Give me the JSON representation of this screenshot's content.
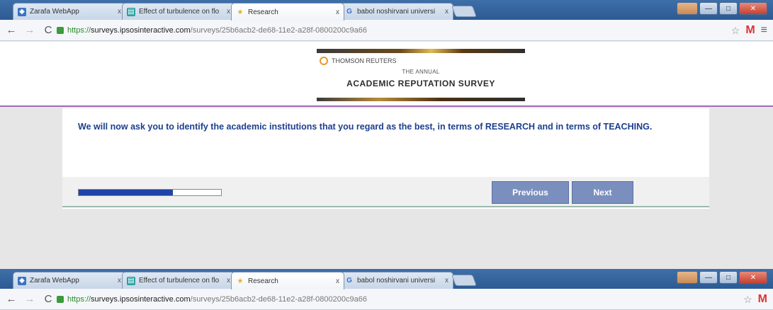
{
  "browser": {
    "tabs": [
      {
        "title": "Zarafa WebApp",
        "icon": "zarafa-icon",
        "color": "#3b73c4"
      },
      {
        "title": "Effect of turbulence on flo",
        "icon": "document-icon",
        "color": "#2aa0a0"
      },
      {
        "title": "Research",
        "icon": "star-icon",
        "color": "#e8b020"
      },
      {
        "title": "babol noshirvani universi",
        "icon": "google-icon",
        "color": "#3b6fd6"
      }
    ],
    "active_tab": 2,
    "url": {
      "scheme": "https://",
      "host": "surveys.ipsosinteractive.com",
      "path": "/surveys/25b6acb2-de68-11e2-a28f-0800200c9a66"
    },
    "gmail_label": "M",
    "tab_close": "x"
  },
  "banner": {
    "brand": "THOMSON REUTERS",
    "subtitle": "THE ANNUAL",
    "title": "ACADEMIC REPUTATION SURVEY"
  },
  "survey": {
    "question": "We will now ask you to identify the academic institutions that you regard as the best, in terms of RESEARCH and in terms of TEACHING.",
    "progress": 0.66,
    "previous_label": "Previous",
    "next_label": "Next"
  },
  "colors": {
    "accent": "#9f6bb8",
    "question_text": "#1c3f8f",
    "button": "#7b8fbf",
    "progress_fill": "#1f43a8"
  }
}
